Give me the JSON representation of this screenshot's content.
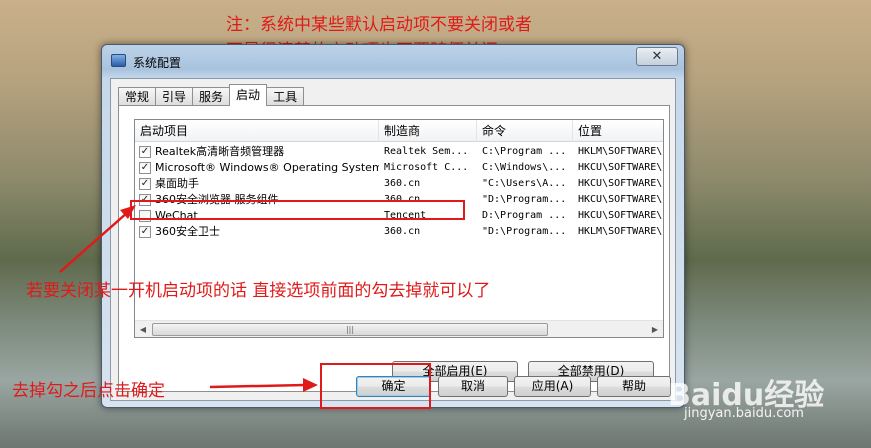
{
  "annotations": {
    "note_line1": "注：系统中某些默认启动项不要关闭或者",
    "note_line2": "不是很清楚的启动项也不要随便关闭",
    "instruction": "若要关闭某一开机启动项的话 直接选项前面的勾去掉就可以了",
    "confirm_hint": "去掉勾之后点击确定"
  },
  "window": {
    "title": "系统配置",
    "close_glyph": "✕"
  },
  "tabs": [
    {
      "label": "常规",
      "active": false
    },
    {
      "label": "引导",
      "active": false
    },
    {
      "label": "服务",
      "active": false
    },
    {
      "label": "启动",
      "active": true
    },
    {
      "label": "工具",
      "active": false
    }
  ],
  "table": {
    "columns": [
      "启动项目",
      "制造商",
      "命令",
      "位置"
    ],
    "rows": [
      {
        "checked": true,
        "name": "Realtek高清晰音频管理器",
        "maker": "Realtek Sem...",
        "command": "C:\\Program ...",
        "location": "HKLM\\SOFTWARE\\"
      },
      {
        "checked": true,
        "name": "Microsoft® Windows® Operating System",
        "maker": "Microsoft C...",
        "command": "C:\\Windows\\...",
        "location": "HKCU\\SOFTWARE\\"
      },
      {
        "checked": true,
        "name": "桌面助手",
        "maker": "360.cn",
        "command": "\"C:\\Users\\A...",
        "location": "HKCU\\SOFTWARE\\"
      },
      {
        "checked": true,
        "name": "360安全浏览器 服务组件",
        "maker": "360.cn",
        "command": "\"D:\\Program...",
        "location": "HKCU\\SOFTWARE\\"
      },
      {
        "checked": false,
        "name": "WeChat",
        "maker": "Tencent",
        "command": "D:\\Program ...",
        "location": "HKCU\\SOFTWARE\\"
      },
      {
        "checked": true,
        "name": "360安全卫士",
        "maker": "360.cn",
        "command": "\"D:\\Program...",
        "location": "HKLM\\SOFTWARE\\"
      }
    ],
    "scroll_grip": "|||"
  },
  "buttons": {
    "enable_all": "全部启用(E)",
    "disable_all": "全部禁用(D)",
    "ok": "确定",
    "cancel": "取消",
    "apply": "应用(A)",
    "help": "帮助"
  },
  "watermark": {
    "brand": "Baidu经验",
    "url": "jingyan.baidu.com"
  },
  "colors": {
    "annotation": "#e01a1a",
    "accent": "#3c7fb1"
  }
}
